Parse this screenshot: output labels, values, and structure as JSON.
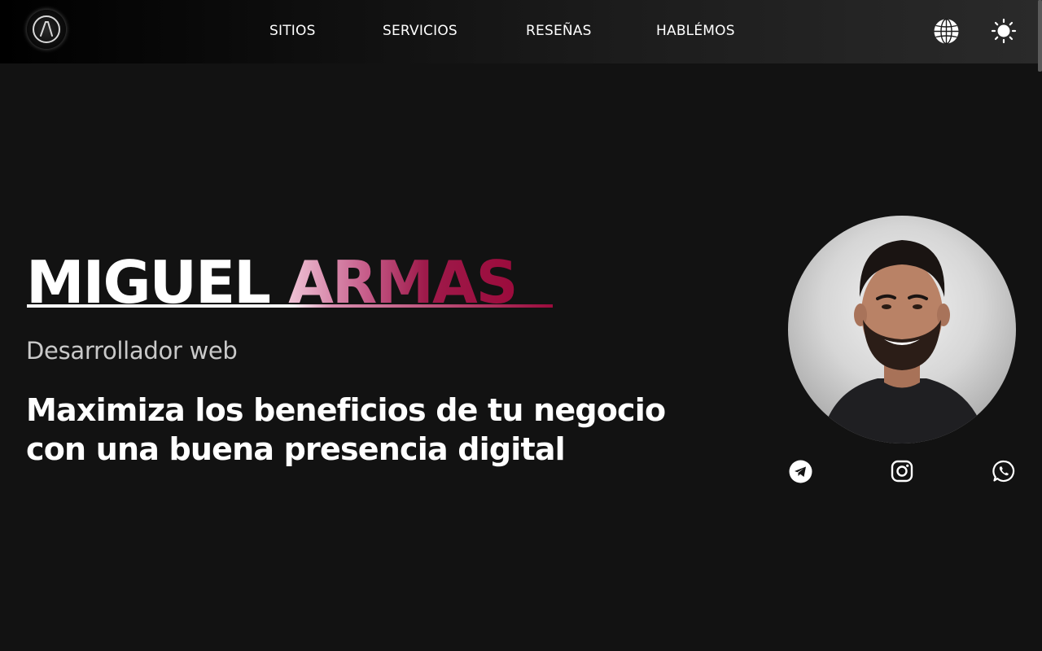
{
  "header": {
    "logo_text": "A",
    "nav": [
      {
        "label": "SITIOS"
      },
      {
        "label": "SERVICIOS"
      },
      {
        "label": "RESEÑAS"
      },
      {
        "label": "HABLÉMOS"
      }
    ],
    "icons": {
      "language": "globe-icon",
      "theme": "sun-icon"
    }
  },
  "hero": {
    "name_first": "MIGUEL ",
    "name_last": "ARMAS",
    "subtitle": "Desarrollador web",
    "tagline": "Maximiza los beneficios de tu negocio con una buena presencia digital"
  },
  "social": [
    {
      "icon": "telegram-icon"
    },
    {
      "icon": "instagram-icon"
    },
    {
      "icon": "whatsapp-icon"
    }
  ],
  "colors": {
    "background": "#121212",
    "accent": "#9b0b3c",
    "accent_light": "#efc3d6",
    "text": "#ffffff",
    "subtitle": "#c9c9c9"
  }
}
